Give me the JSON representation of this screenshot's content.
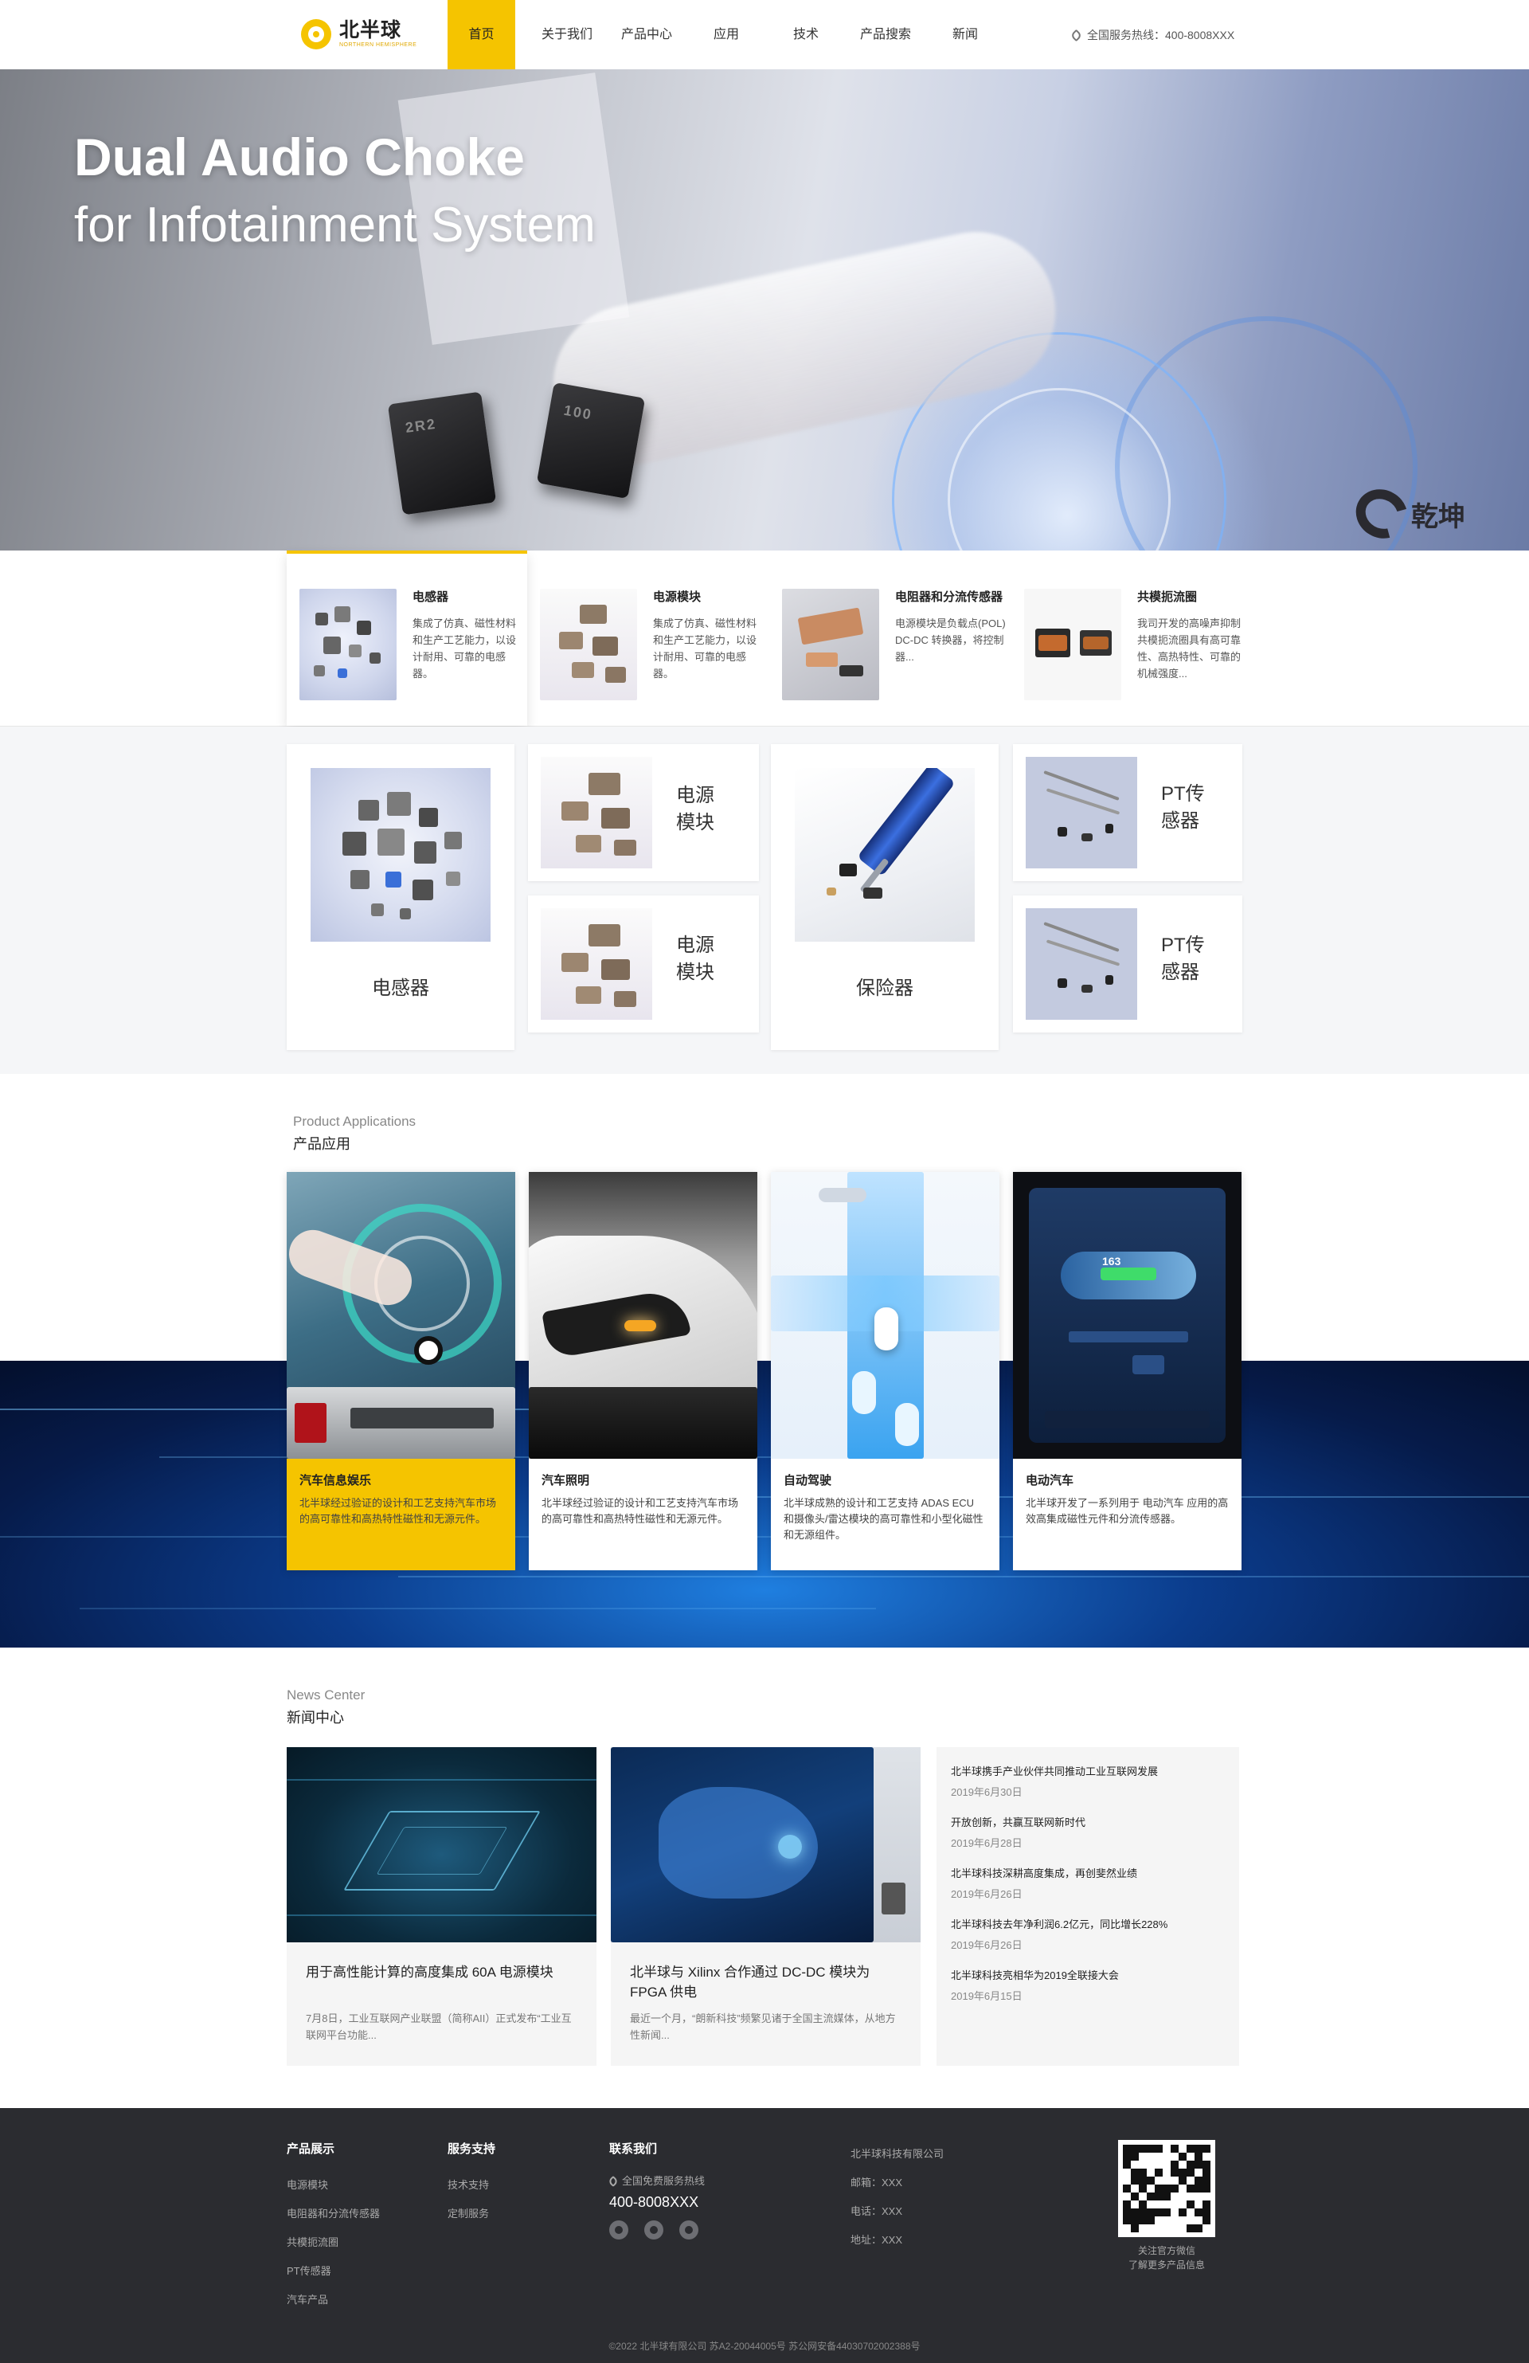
{
  "header": {
    "logo_cn": "北半球",
    "logo_en": "NORTHERN HEMISPHERE",
    "nav": [
      "首页",
      "关于我们",
      "产品中心",
      "应用",
      "技术",
      "产品搜索",
      "新闻"
    ],
    "hotline": "全国服务热线：400-8008XXX",
    "accent": "#f5c400"
  },
  "hero": {
    "line1": "Dual Audio Choke",
    "line2": "for Infotainment System",
    "chip1": "2R2",
    "chip2": "100",
    "brand": "乾坤"
  },
  "strip": [
    {
      "title": "电感器",
      "desc": "集成了仿真、磁性材料和生产工艺能力，以设计耐用、可靠的电感器。"
    },
    {
      "title": "电源模块",
      "desc": "集成了仿真、磁性材料和生产工艺能力，以设计耐用、可靠的电感器。"
    },
    {
      "title": "电阻器和分流传感器",
      "desc": "电源模块是负载点(POL) DC-DC 转换器，将控制器..."
    },
    {
      "title": "共模扼流圈",
      "desc": "我司开发的高噪声抑制共模扼流圈具有高可靠性、高热特性、可靠的机械强度..."
    }
  ],
  "grid": {
    "inductor": "电感器",
    "power1": "电源模块",
    "power2": "电源模块",
    "fuse": "保险器",
    "pt1": "PT传感器",
    "pt2": "PT传感器"
  },
  "apps": {
    "en": "Product Applications",
    "cn": "产品应用",
    "items": [
      {
        "title": "汽车信息娱乐",
        "desc": "北半球经过验证的设计和工艺支持汽车市场的高可靠性和高热特性磁性和无源元件。"
      },
      {
        "title": "汽车照明",
        "desc": "北半球经过验证的设计和工艺支持汽车市场的高可靠性和高热特性磁性和无源元件。"
      },
      {
        "title": "自动驾驶",
        "desc": "北半球成熟的设计和工艺支持 ADAS ECU 和摄像头/雷达模块的高可靠性和小型化磁性和无源组件。"
      },
      {
        "title": "电动汽车",
        "desc": "北半球开发了一系列用于 电动汽车 应用的高效高集成磁性元件和分流传感器。"
      }
    ],
    "dash_value": "163"
  },
  "news": {
    "en": "News Center",
    "cn": "新闻中心",
    "cards": [
      {
        "title": "用于高性能计算的高度集成 60A 电源模块",
        "desc": "7月8日，工业互联网产业联盟（简称AII）正式发布“工业互联网平台功能..."
      },
      {
        "title": "北半球与 Xilinx 合作通过 DC-DC 模块为 FPGA 供电",
        "desc": "最近一个月，“朗新科技”频繁见诸于全国主流媒体，从地方性新闻..."
      }
    ],
    "list": [
      {
        "title": "北半球携手产业伙伴共同推动工业互联网发展",
        "date": "2019年6月30日"
      },
      {
        "title": "开放创新，共赢互联网新时代",
        "date": "2019年6月28日"
      },
      {
        "title": "北半球科技深耕高度集成，再创斐然业绩",
        "date": "2019年6月26日"
      },
      {
        "title": "北半球科技去年净利润6.2亿元，同比增长228%",
        "date": "2019年6月26日"
      },
      {
        "title": "北半球科技亮相华为2019全联接大会",
        "date": "2019年6月15日"
      }
    ]
  },
  "footer": {
    "col1": {
      "head": "产品展示",
      "links": [
        "电源模块",
        "电阻器和分流传感器",
        "共模扼流圈",
        "PT传感器",
        "汽车产品"
      ]
    },
    "col2": {
      "head": "服务支持",
      "links": [
        "技术支持",
        "定制服务"
      ]
    },
    "col3": {
      "head": "联系我们",
      "label": "全国免费服务热线",
      "phone": "400-8008XXX"
    },
    "company": "北半球科技有限公司",
    "email": "邮箱：XXX",
    "tel": "电话：XXX",
    "addr": "地址：XXX",
    "qr_caption1": "关注官方微信",
    "qr_caption2": "了解更多产品信息",
    "copyright": "©2022 北半球有限公司 苏A2-20044005号 苏公网安备44030702002388号"
  }
}
